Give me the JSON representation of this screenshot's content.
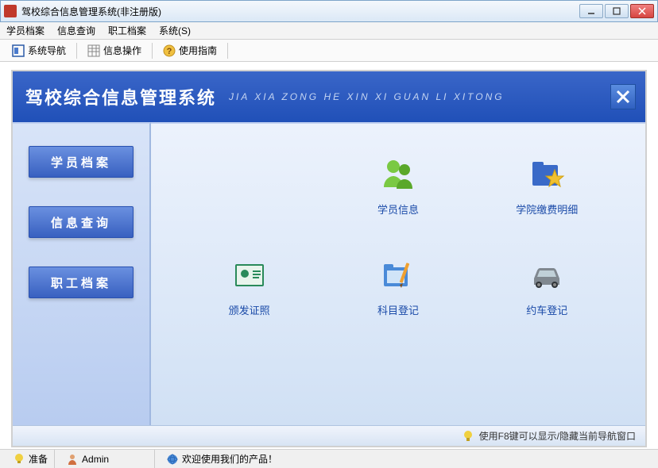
{
  "window": {
    "title": "驾校综合信息管理系统(非注册版)"
  },
  "menu": {
    "items": [
      "学员档案",
      "信息查询",
      "职工档案",
      "系统(S)"
    ]
  },
  "toolbar": {
    "nav": "系统导航",
    "info": "信息操作",
    "guide": "使用指南"
  },
  "banner": {
    "title": "驾校综合信息管理系统",
    "subtitle": "JIA XIA ZONG HE XIN XI GUAN LI XITONG"
  },
  "sidebar": {
    "items": [
      "学员档案",
      "信息查询",
      "职工档案"
    ]
  },
  "apps": {
    "student_info": "学员信息",
    "fee_detail": "学院缴费明细",
    "issue_license": "颁发证照",
    "subject_reg": "科目登记",
    "car_booking": "约车登记"
  },
  "hint": "使用F8键可以显示/隐藏当前导航窗口",
  "status": {
    "ready": "准备",
    "user": "Admin",
    "welcome": "欢迎使用我们的产品！"
  }
}
